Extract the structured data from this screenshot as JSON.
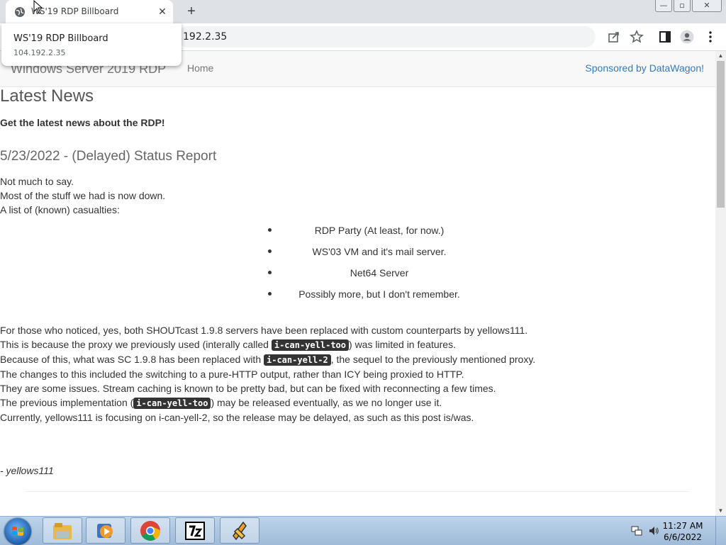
{
  "browser": {
    "tab": {
      "title": "WS'19 RDP Billboard",
      "close": "✕"
    },
    "new_tab": "+",
    "window_buttons": {
      "minimize": "—",
      "maximize": "▫",
      "close": "✕"
    },
    "omnibox": {
      "url_visible": "192.2.35"
    },
    "hover_card": {
      "title": "WS'19 RDP Billboard",
      "url": "104.192.2.35"
    }
  },
  "navbar": {
    "brand": "Windows Server 2019 RDP",
    "home": "Home",
    "sponsor": "Sponsored by DataWagon!"
  },
  "content": {
    "heading": "Latest News",
    "lead": "Get the latest news about the RDP!",
    "post_title": "5/23/2022 - (Delayed) Status Report",
    "intro": [
      "Not much to say.",
      "Most of the stuff we had is now down.",
      "A list of (known) casualties:"
    ],
    "casualties": [
      "RDP Party (At least, for now.)",
      "WS'03 VM and it's mail server.",
      "Net64 Server",
      "Possibly more, but I don't remember."
    ],
    "p1": "For those who noticed, yes, both SHOUTcast 1.9.8 servers have been replaced with custom counterparts by yellows111.",
    "p2_a": "This is because the proxy we previously used (interally called ",
    "p2_code": "i-can-yell-too",
    "p2_b": ") was limited in features.",
    "p3_a": "Because of this, what was SC 1.9.8 has been replaced with ",
    "p3_code": "i-can-yell-2",
    "p3_b": ", the sequel to the previously mentioned proxy.",
    "p4": "The changes to this included the switching to a pure-HTTP output, rather than ICY being proxied to HTTP.",
    "p5": "They are some issues. Stream caching is known to be pretty bad, but can be fixed with reconnecting a few times.",
    "p6_a": "The previous implementation (",
    "p6_code": "i-can-yell-too",
    "p6_b": ") may be released eventually, as we no longer use it.",
    "p7": "Currently, yellows111 is focusing on i-can-yell-2, so the release may be delayed, as such as this post is/was.",
    "signature": "- yellows111"
  },
  "taskbar": {
    "time": "11:27 AM",
    "date": "6/6/2022",
    "apps": [
      "explorer-icon",
      "media-player-icon",
      "chrome-icon",
      "7zip-icon",
      "winamp-icon"
    ]
  },
  "colors": {
    "link": "#337ab7",
    "navbar_bg": "#f8f8f8",
    "code_bg": "#333333",
    "taskbar": "#bcd3ea"
  }
}
